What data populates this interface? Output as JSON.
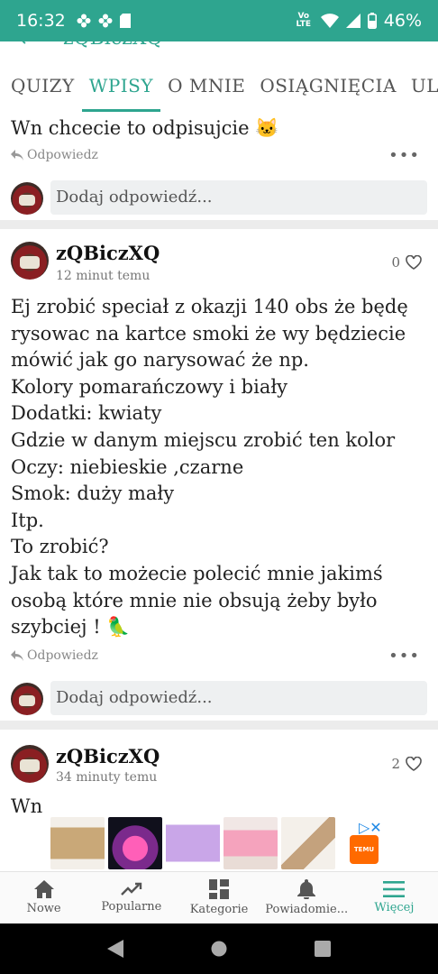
{
  "status_bar": {
    "time": "16:32",
    "network": "Vo LTE",
    "battery": "46%"
  },
  "header": {
    "title_partial": "zQBiczXQ"
  },
  "tabs": [
    {
      "label": "QUIZY"
    },
    {
      "label": "WPISY"
    },
    {
      "label": "O MNIE"
    },
    {
      "label": "OSIĄGNIĘCIA"
    },
    {
      "label": "ULUBI"
    }
  ],
  "top_comment": {
    "text": "Wn chcecie to odpisujcie 🐱",
    "reply_label": "Odpowiedz",
    "reply_placeholder": "Dodaj odpowiedź..."
  },
  "posts": [
    {
      "username": "zQBiczXQ",
      "time": "12 minut temu",
      "likes": "0",
      "lines": [
        "Ej zrobić speciał z okazji 140 obs że będę",
        "rysowac na kartce smoki że wy będziecie",
        "mówić jak go narysować że np.",
        "Kolory pomarańczowy i biały",
        "Dodatki: kwiaty",
        "Gdzie w danym miejscu zrobić ten kolor",
        "Oczy: niebieskie ,czarne",
        "Smok: duży mały",
        "Itp.",
        "To zrobić?",
        "Jak tak to możecie polecić mnie jakimś",
        "osobą które mnie nie obsują żeby było",
        "szybciej ! 🦜"
      ],
      "reply_label": "Odpowiedz",
      "reply_placeholder": "Dodaj odpowiedź..."
    },
    {
      "username": "zQBiczXQ",
      "time": "34 minuty temu",
      "likes": "2",
      "text": "Wn"
    }
  ],
  "ad": {
    "logo_text": "TEMU"
  },
  "bottom_nav": [
    {
      "label": "Nowe",
      "icon": "home-icon"
    },
    {
      "label": "Popularne",
      "icon": "trending-icon"
    },
    {
      "label": "Kategorie",
      "icon": "grid-icon"
    },
    {
      "label": "Powiadomie...",
      "icon": "bell-icon"
    },
    {
      "label": "Więcej",
      "icon": "menu-icon"
    }
  ],
  "colors": {
    "accent": "#2ea58f",
    "separator": "#ececec",
    "input_bg": "#eef0f1"
  }
}
